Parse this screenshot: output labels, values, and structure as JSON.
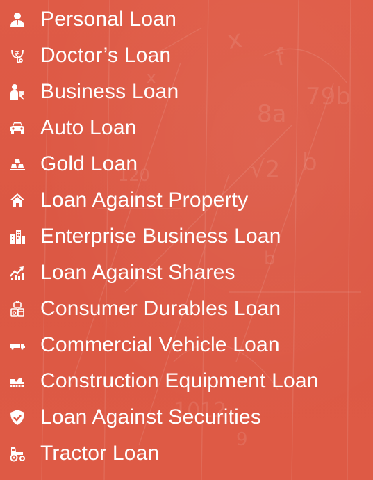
{
  "menu": {
    "items": [
      {
        "label": "Personal Loan",
        "icon": "person-icon"
      },
      {
        "label": "Doctor’s Loan",
        "icon": "rupee-stethoscope-icon"
      },
      {
        "label": "Business Loan",
        "icon": "businessman-rupee-icon"
      },
      {
        "label": "Auto Loan",
        "icon": "car-icon"
      },
      {
        "label": "Gold Loan",
        "icon": "gold-bars-icon"
      },
      {
        "label": "Loan Against Property",
        "icon": "home-icon"
      },
      {
        "label": "Enterprise Business Loan",
        "icon": "buildings-icon"
      },
      {
        "label": "Loan Against Shares",
        "icon": "stock-chart-icon"
      },
      {
        "label": "Consumer Durables Loan",
        "icon": "tv-appliance-icon"
      },
      {
        "label": "Commercial Vehicle Loan",
        "icon": "truck-icon"
      },
      {
        "label": "Construction Equipment Loan",
        "icon": "excavator-icon"
      },
      {
        "label": "Loan Against Securities",
        "icon": "shield-check-icon"
      },
      {
        "label": "Tractor Loan",
        "icon": "tractor-icon"
      }
    ]
  },
  "colors": {
    "background": "#de5a45",
    "text": "#ffffff"
  }
}
